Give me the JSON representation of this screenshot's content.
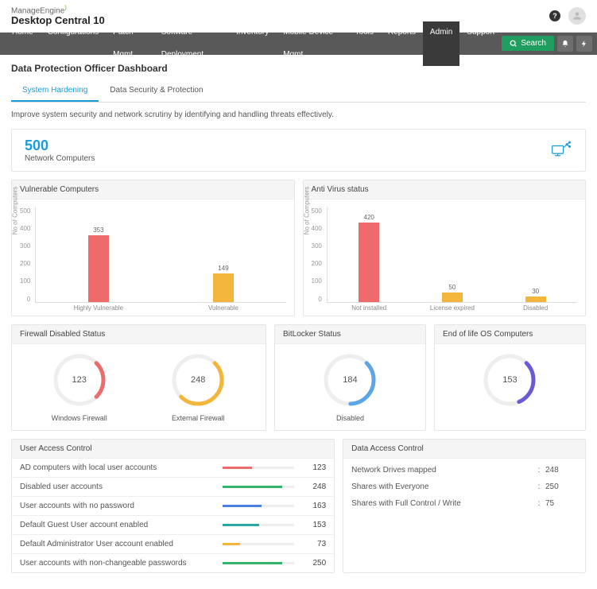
{
  "brand": {
    "company": "ManageEngine",
    "product": "Desktop Central 10"
  },
  "nav": {
    "items": [
      "Home",
      "Configurations",
      "Patch Mgmt",
      "Software Deployment",
      "Inventory",
      "Mobile Device Mgmt",
      "Tools",
      "Reports",
      "Admin",
      "Support"
    ],
    "active_index": 8,
    "search": "Search"
  },
  "page_title": "Data Protection Officer Dashboard",
  "tabs": {
    "items": [
      "System Hardening",
      "Data Security & Protection"
    ],
    "active_index": 0
  },
  "subtitle": "Improve system security and network scrutiny by identifying and handling threats effectively.",
  "hero": {
    "value": "500",
    "label": "Network Computers"
  },
  "chart_data": [
    {
      "id": "vulnerable",
      "title": "Vulnerable Computers",
      "type": "bar",
      "ylabel": "No of Computers",
      "ylim": [
        0,
        500
      ],
      "ticks": [
        0,
        100,
        200,
        300,
        400,
        500
      ],
      "categories": [
        "Highly Vulnerable",
        "Vulnerable"
      ],
      "values": [
        353,
        149
      ],
      "colors": [
        "#ef6a6a",
        "#f3b63d"
      ]
    },
    {
      "id": "antivirus",
      "title": "Anti Virus status",
      "type": "bar",
      "ylabel": "No of Computers",
      "ylim": [
        0,
        500
      ],
      "ticks": [
        0,
        100,
        200,
        300,
        400,
        500
      ],
      "categories": [
        "Not installed",
        "License expired",
        "Disabled"
      ],
      "values": [
        420,
        50,
        30
      ],
      "colors": [
        "#ef6a6a",
        "#f3b63d",
        "#f3b63d"
      ]
    }
  ],
  "firewall": {
    "title": "Firewall Disabled Status",
    "items": [
      {
        "label": "Windows Firewall",
        "value": 123,
        "percent": 25,
        "color": "#ef6a6a"
      },
      {
        "label": "External Firewall",
        "value": 248,
        "percent": 50,
        "color": "#f3b63d"
      }
    ]
  },
  "bitlocker": {
    "title": "BitLocker Status",
    "label": "Disabled",
    "value": 184,
    "percent": 37,
    "color": "#5aa6e6"
  },
  "eol": {
    "title": "End of life OS Computers",
    "value": 153,
    "percent": 31,
    "color": "#6b5bd2"
  },
  "uac": {
    "title": "User Access Control",
    "max": 300,
    "items": [
      {
        "label": "AD computers with local  user accounts",
        "value": 123,
        "color": "#ef6a6a"
      },
      {
        "label": "Disabled user accounts",
        "value": 248,
        "color": "#34b36b"
      },
      {
        "label": "User accounts with no password",
        "value": 163,
        "color": "#4a7fe0"
      },
      {
        "label": "Default Guest User account  enabled",
        "value": 153,
        "color": "#2aa8a8"
      },
      {
        "label": "Default Administrator User account enabled",
        "value": 73,
        "color": "#f3b63d"
      },
      {
        "label": "User accounts with non-changeable passwords",
        "value": 250,
        "color": "#34b36b"
      }
    ]
  },
  "dac": {
    "title": "Data Access Control",
    "items": [
      {
        "label": "Network Drives mapped",
        "value": 248
      },
      {
        "label": "Shares with Everyone",
        "value": 250
      },
      {
        "label": "Shares with Full Control / Write",
        "value": 75
      }
    ]
  }
}
